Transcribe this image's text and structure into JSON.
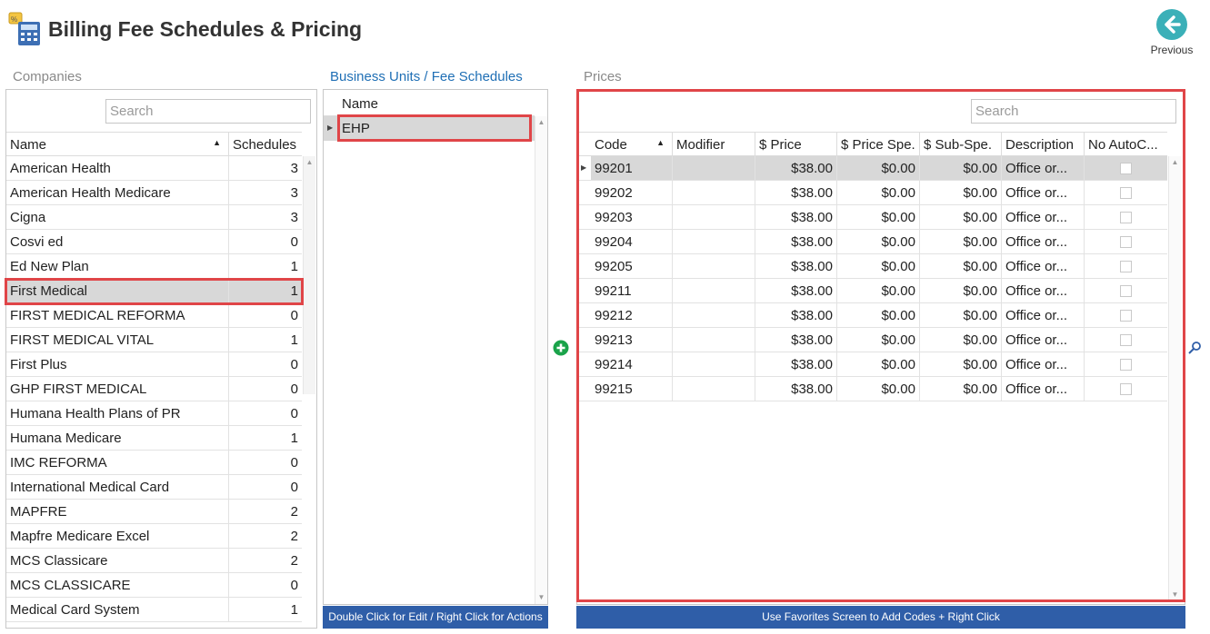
{
  "app": {
    "title": "Billing Fee Schedules & Pricing",
    "previous_label": "Previous"
  },
  "sections": {
    "companies": "Companies",
    "business_units": "Business Units / Fee Schedules",
    "prices": "Prices"
  },
  "companies": {
    "search_placeholder": "Search",
    "col_name": "Name",
    "col_schedules": "Schedules",
    "rows": [
      {
        "name": "American Health",
        "schedules": "3"
      },
      {
        "name": "American Health Medicare",
        "schedules": "3"
      },
      {
        "name": "Cigna",
        "schedules": "3"
      },
      {
        "name": "Cosvi ed",
        "schedules": "0"
      },
      {
        "name": "Ed New Plan",
        "schedules": "1"
      },
      {
        "name": "First Medical",
        "schedules": "1"
      },
      {
        "name": "FIRST MEDICAL REFORMA",
        "schedules": "0"
      },
      {
        "name": "FIRST MEDICAL VITAL",
        "schedules": "1"
      },
      {
        "name": "First Plus",
        "schedules": "0"
      },
      {
        "name": "GHP FIRST MEDICAL",
        "schedules": "0"
      },
      {
        "name": "Humana Health Plans of PR",
        "schedules": "0"
      },
      {
        "name": "Humana Medicare",
        "schedules": "1"
      },
      {
        "name": "IMC REFORMA",
        "schedules": "0"
      },
      {
        "name": "International Medical Card",
        "schedules": "0"
      },
      {
        "name": "MAPFRE",
        "schedules": "2"
      },
      {
        "name": "Mapfre Medicare Excel",
        "schedules": "2"
      },
      {
        "name": "MCS Classicare",
        "schedules": "2"
      },
      {
        "name": "MCS CLASSICARE",
        "schedules": "0"
      },
      {
        "name": "Medical Card System",
        "schedules": "1"
      }
    ]
  },
  "business_units": {
    "col_name": "Name",
    "rows": [
      {
        "name": "EHP"
      }
    ],
    "footer": "Double Click for Edit / Right Click for Actions"
  },
  "prices": {
    "search_placeholder": "Search",
    "columns": [
      "Code",
      "Modifier",
      "$ Price",
      "$ Price Spe.",
      "$ Sub-Spe.",
      "Description",
      "No AutoC..."
    ],
    "rows": [
      {
        "code": "99201",
        "modifier": "",
        "price": "$38.00",
        "price_spe": "$0.00",
        "sub_spe": "$0.00",
        "description": "Office or..."
      },
      {
        "code": "99202",
        "modifier": "",
        "price": "$38.00",
        "price_spe": "$0.00",
        "sub_spe": "$0.00",
        "description": "Office or..."
      },
      {
        "code": "99203",
        "modifier": "",
        "price": "$38.00",
        "price_spe": "$0.00",
        "sub_spe": "$0.00",
        "description": "Office or..."
      },
      {
        "code": "99204",
        "modifier": "",
        "price": "$38.00",
        "price_spe": "$0.00",
        "sub_spe": "$0.00",
        "description": "Office or..."
      },
      {
        "code": "99205",
        "modifier": "",
        "price": "$38.00",
        "price_spe": "$0.00",
        "sub_spe": "$0.00",
        "description": "Office or..."
      },
      {
        "code": "99211",
        "modifier": "",
        "price": "$38.00",
        "price_spe": "$0.00",
        "sub_spe": "$0.00",
        "description": "Office or..."
      },
      {
        "code": "99212",
        "modifier": "",
        "price": "$38.00",
        "price_spe": "$0.00",
        "sub_spe": "$0.00",
        "description": "Office or..."
      },
      {
        "code": "99213",
        "modifier": "",
        "price": "$38.00",
        "price_spe": "$0.00",
        "sub_spe": "$0.00",
        "description": "Office or..."
      },
      {
        "code": "99214",
        "modifier": "",
        "price": "$38.00",
        "price_spe": "$0.00",
        "sub_spe": "$0.00",
        "description": "Office or..."
      },
      {
        "code": "99215",
        "modifier": "",
        "price": "$38.00",
        "price_spe": "$0.00",
        "sub_spe": "$0.00",
        "description": "Office or..."
      }
    ],
    "footer": "Use Favorites Screen to Add Codes + Right Click"
  },
  "colors": {
    "accent": "#2f5ea8",
    "highlight": "#e04548",
    "add": "#1aa34a",
    "previous": "#3bb0b8",
    "link": "#1f6fb5"
  },
  "icons": {
    "app": "calculator-icon",
    "previous": "arrow-left-icon",
    "add": "plus-circle-icon",
    "zoom": "magnifier-icon"
  }
}
